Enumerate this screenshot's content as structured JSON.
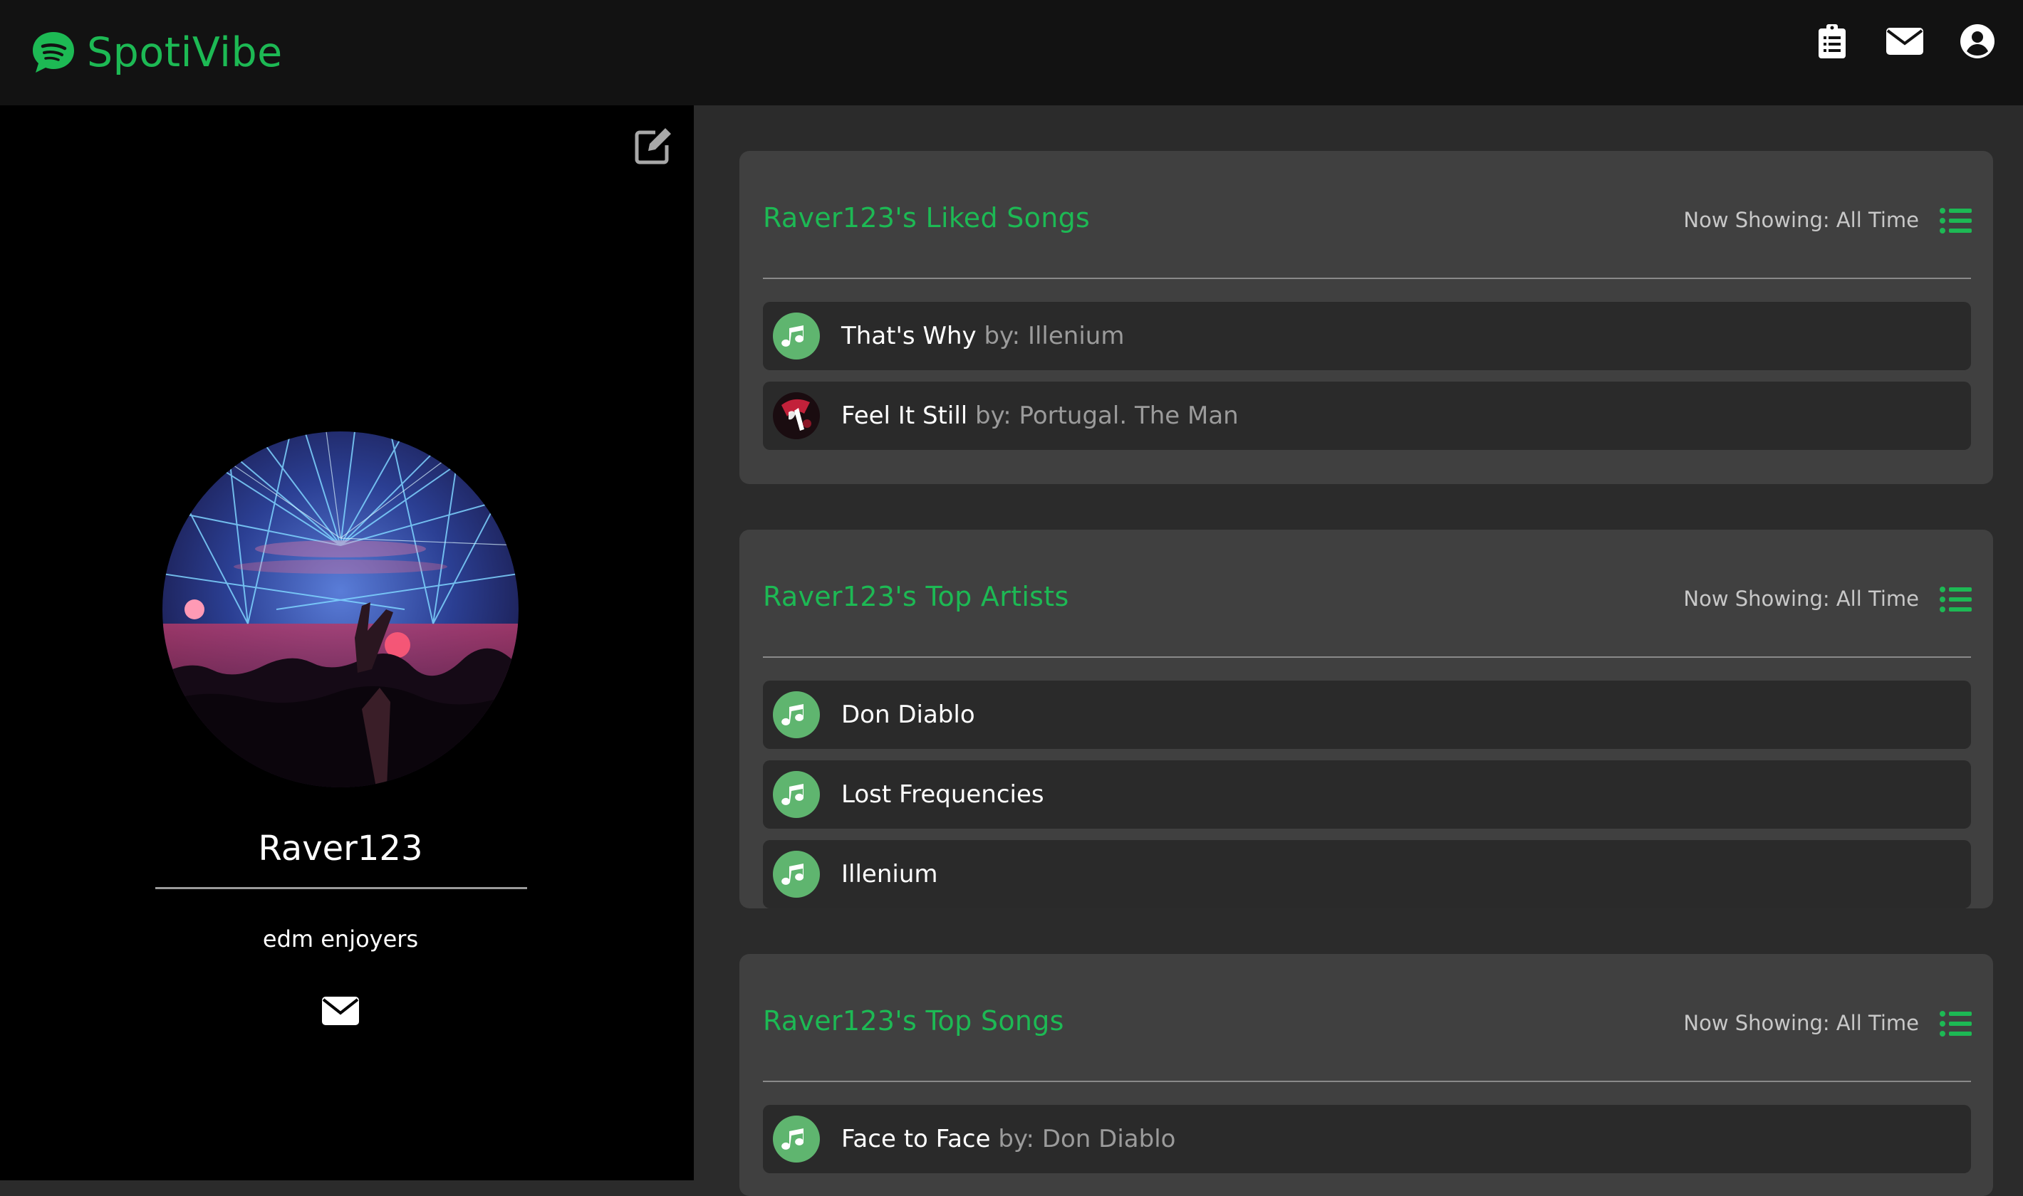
{
  "app": {
    "brand_name": "SpotiVibe",
    "accent_color": "#1db954",
    "logo_icon": "spotify-logo-icon"
  },
  "nav": {
    "icons": [
      "clipboard-list-icon",
      "envelope-icon",
      "user-circle-icon"
    ]
  },
  "profile": {
    "username": "Raver123",
    "bio": "edm enjoyers",
    "avatar_icon": "concert-lasers-avatar",
    "edit_icon": "edit-icon",
    "message_icon": "envelope-icon"
  },
  "liked_songs": {
    "title": "Raver123's Liked Songs",
    "showing": "Now Showing: All Time",
    "items": [
      {
        "name": "That's Why",
        "by": "by: Illenium",
        "icon": "music-note-icon"
      },
      {
        "name": "Feel It Still",
        "by": "by: Portugal. The Man",
        "icon": "album-art-icon"
      }
    ]
  },
  "top_artists": {
    "title": "Raver123's Top Artists",
    "showing": "Now Showing: All Time",
    "items": [
      {
        "name": "Don Diablo",
        "icon": "music-note-icon"
      },
      {
        "name": "Lost Frequencies",
        "icon": "music-note-icon"
      },
      {
        "name": "Illenium",
        "icon": "music-note-icon"
      }
    ]
  },
  "top_songs": {
    "title": "Raver123's Top Songs",
    "showing": "Now Showing: All Time",
    "items": [
      {
        "name": "Face to Face",
        "by": "by: Don Diablo",
        "icon": "music-note-icon"
      }
    ]
  }
}
